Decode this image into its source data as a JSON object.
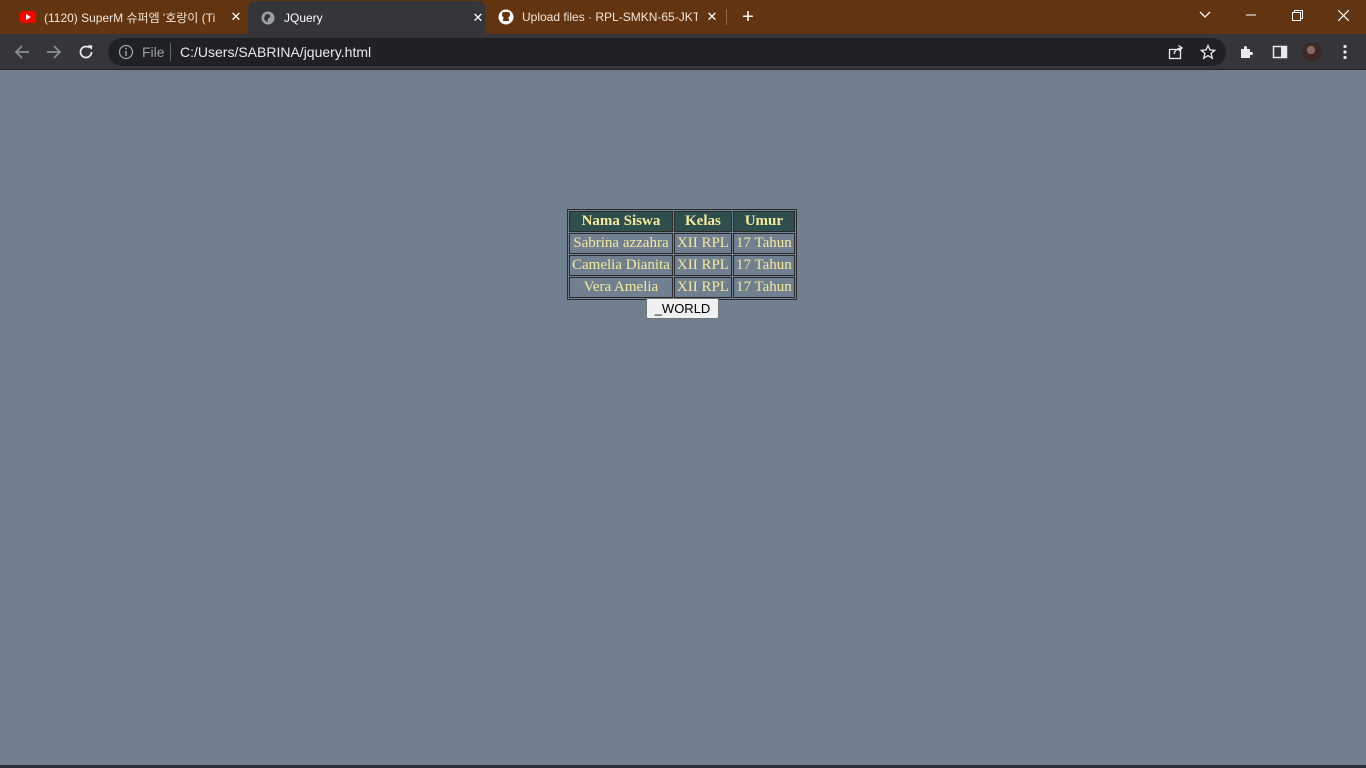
{
  "browser": {
    "tabs": [
      {
        "title": "(1120) SuperM 슈퍼엠 '호랑이 (Ti",
        "icon": "youtube-icon",
        "active": false
      },
      {
        "title": "JQuery",
        "icon": "globe-icon",
        "active": true
      },
      {
        "title": "Upload files · RPL-SMKN-65-JKT/",
        "icon": "github-icon",
        "active": false
      }
    ],
    "new_tab_label": "+",
    "address_bar": {
      "scheme_label": "File",
      "url": "C:/Users/SABRINA/jquery.html"
    },
    "colors": {
      "tab_strip": "#623410",
      "toolbar": "#35363a",
      "omnibox": "#202124"
    }
  },
  "page": {
    "background": "#708090",
    "table": {
      "headers": [
        "Nama Siswa",
        "Kelas",
        "Umur"
      ],
      "rows": [
        [
          "Sabrina azzahra",
          "XII RPL",
          "17 Tahun"
        ],
        [
          "Camelia Dianita",
          "XII RPL",
          "17 Tahun"
        ],
        [
          "Vera Amelia",
          "XII RPL",
          "17 Tahun"
        ]
      ],
      "colors": {
        "header_bg": "#2f4f4f",
        "text": "#f5e99a"
      }
    },
    "button_label": "_WORLD"
  }
}
